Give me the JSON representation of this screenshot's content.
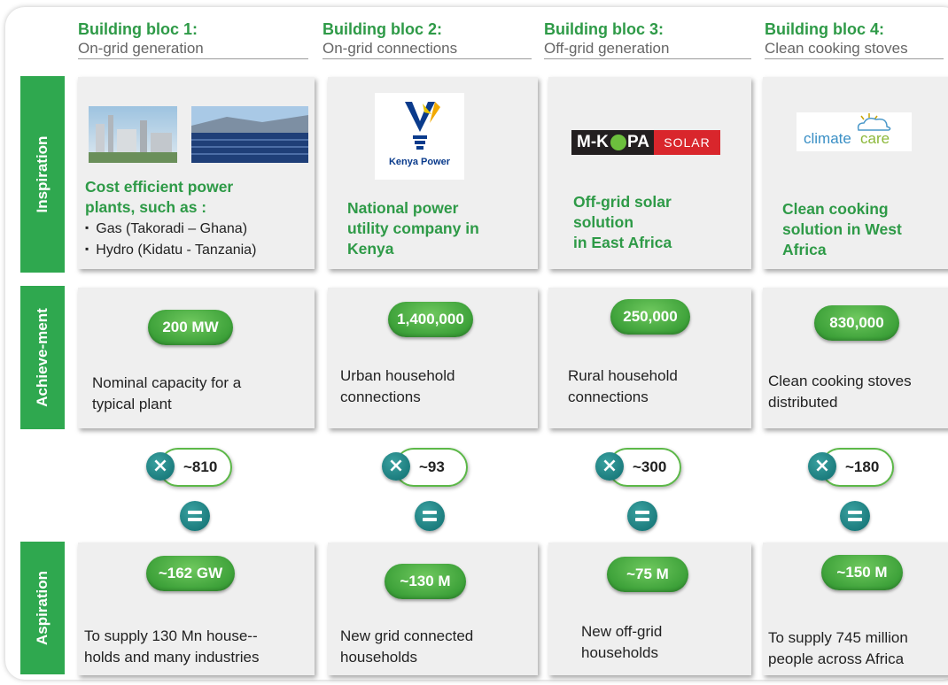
{
  "columns": [
    {
      "title": "Building bloc 1:",
      "subtitle": "On-grid generation"
    },
    {
      "title": "Building bloc 2:",
      "subtitle": "On-grid connections"
    },
    {
      "title": "Building bloc 3:",
      "subtitle": "Off-grid generation"
    },
    {
      "title": "Building bloc 4:",
      "subtitle": "Clean cooking stoves"
    }
  ],
  "rows": {
    "inspiration": "Inspiration",
    "achievement": "Achieve-ment",
    "aspiration": "Aspiration"
  },
  "inspiration": [
    {
      "lines": [
        "Cost efficient power",
        "plants, such as :"
      ],
      "bullets": [
        "Gas (Takoradi – Ghana)",
        "Hydro (Kidatu - Tanzania)"
      ]
    },
    {
      "lines": [
        "National power",
        "utility company in",
        "Kenya"
      ],
      "logo": "Kenya Power"
    },
    {
      "lines": [
        "Off-grid solar",
        "solution",
        "in East Africa"
      ],
      "logo": {
        "part1": "M-K",
        "part2": "PA",
        "part3": "SOLAR"
      }
    },
    {
      "lines": [
        "Clean cooking",
        "solution in West",
        "Africa"
      ],
      "logo": {
        "part1": "climate",
        "part2": "care"
      }
    }
  ],
  "achievement": [
    {
      "value": "200 MW",
      "lines": [
        "Nominal capacity for a",
        "typical plant"
      ]
    },
    {
      "value": "1,400,000",
      "lines": [
        "Urban household",
        "connections"
      ]
    },
    {
      "value": "250,000",
      "lines": [
        "Rural household",
        "connections"
      ]
    },
    {
      "value": "830,000",
      "lines": [
        "Clean cooking stoves",
        "distributed"
      ]
    }
  ],
  "multipliers": [
    "~810",
    "~93",
    "~300",
    "~180"
  ],
  "aspiration": [
    {
      "value": "~162 GW",
      "lines": [
        "To supply 130 Mn house--",
        "holds and many industries"
      ]
    },
    {
      "value": "~130 M",
      "lines": [
        "New grid connected",
        "households"
      ]
    },
    {
      "value": "~75 M",
      "lines": [
        "New off-grid",
        "households"
      ]
    },
    {
      "value": "~150 M",
      "lines": [
        "To supply 745 million",
        "people across Africa"
      ]
    }
  ],
  "colors": {
    "green": "#2e9a47",
    "label_bg": "#2fa84f",
    "teal": "#0f6d6f",
    "card": "#efefef"
  }
}
